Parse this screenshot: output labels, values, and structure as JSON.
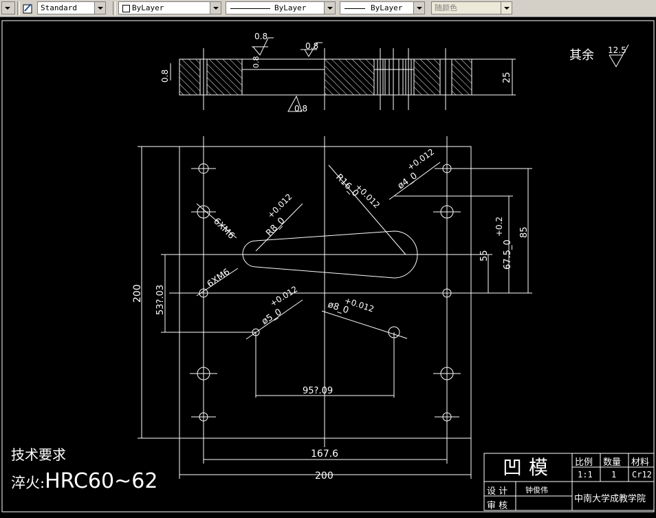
{
  "toolbar": {
    "textstyle": "Standard",
    "layer": "ByLayer",
    "linetype": "ByLayer",
    "lineweight": "ByLayer",
    "plotstyle": "随颜色"
  },
  "drawing": {
    "roughness_note": "其余",
    "roughness_value": "12.5",
    "section_roughness_top": "0.8",
    "section_roughness_top2": "0.8",
    "section_roughness_left": "0.8",
    "section_roughness_bottom": "0.8",
    "section_roughness_mid": "0.8",
    "section_height": "25",
    "plate_height": "200",
    "plate_width": "200",
    "hole_span": "167.6",
    "dim_853": "53?.03",
    "dim_95": "95?.09",
    "dim_55": "55",
    "dim_675": "67.5_0",
    "dim_675_tol": "+0.2",
    "dim_85": "85",
    "thread1": "6XM6",
    "thread2": "6XM6",
    "r8": "R8_0",
    "r8_tol": "+0.012",
    "r16": "R16_0",
    "r16_tol": "+0.012",
    "phi4": "ø4_0",
    "phi4_tol": "+0.012",
    "phi5": "ø5_0",
    "phi5_tol": "+0.012",
    "phi8": "ø8_0",
    "phi8_tol": "+0.012"
  },
  "notes": {
    "tech_title": "技术要求",
    "quench_label": "淬火:",
    "quench_value": "HRC60~62"
  },
  "titleblock": {
    "title": "凹模",
    "scale_label": "比例",
    "qty_label": "数量",
    "material_label": "材料",
    "scale": "1:1",
    "qty": "1",
    "material": "Cr12",
    "design_label": "设 计",
    "designer": "钟俊伟",
    "review_label": "审 核",
    "school": "中南大学成教学院"
  },
  "colors": {
    "background": "#000000",
    "lines": "#ffffff",
    "toolbar": "#d4d0c8"
  }
}
